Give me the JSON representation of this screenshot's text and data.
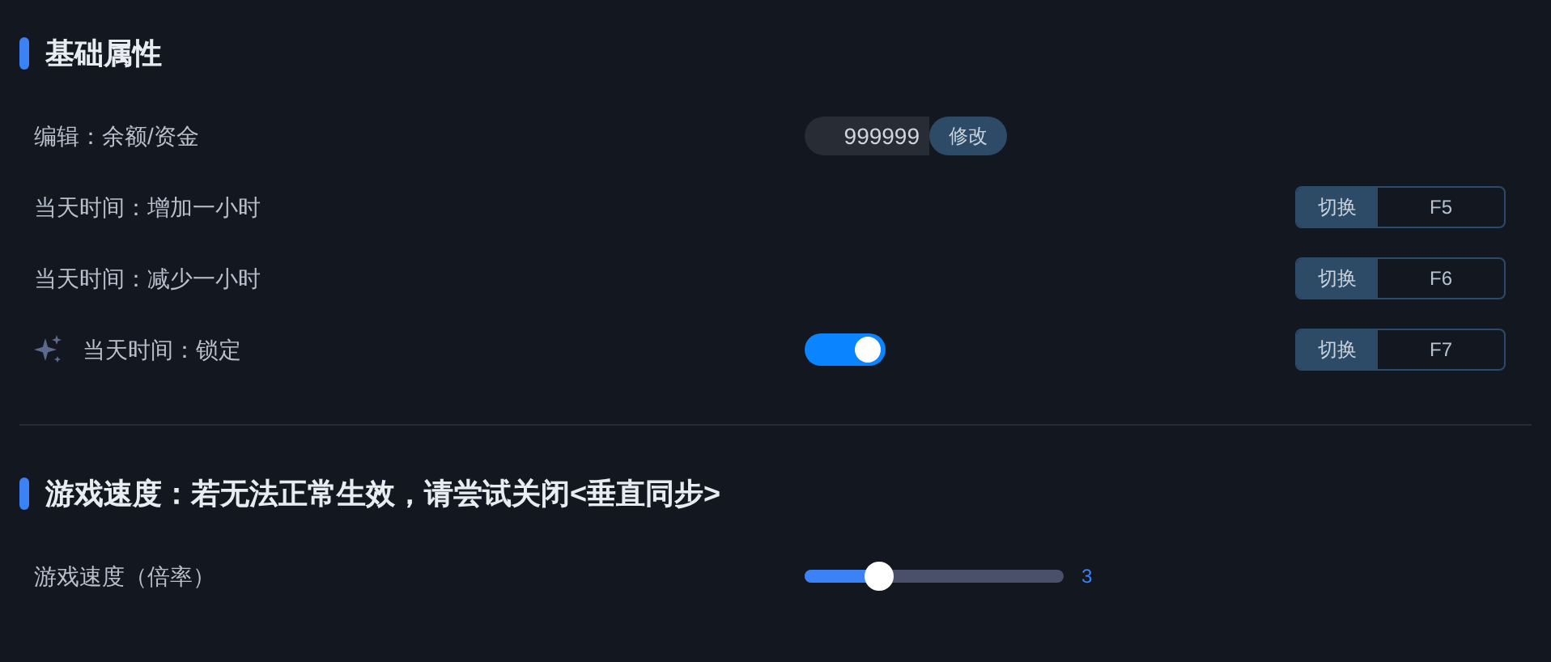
{
  "sections": [
    {
      "title": "基础属性",
      "rows": [
        {
          "kind": "input",
          "label": "编辑：余额/资金",
          "value": "999999",
          "button": "修改"
        },
        {
          "kind": "hotkey",
          "label": "当天时间：增加一小时",
          "switch": "切换",
          "key": "F5"
        },
        {
          "kind": "hotkey",
          "label": "当天时间：减少一小时",
          "switch": "切换",
          "key": "F6"
        },
        {
          "kind": "toggle",
          "label": "当天时间：锁定",
          "on": true,
          "switch": "切换",
          "key": "F7"
        }
      ]
    },
    {
      "title": "游戏速度：若无法正常生效，请尝试关闭<垂直同步>",
      "rows": [
        {
          "kind": "slider",
          "label": "游戏速度（倍率）",
          "level": 0.29,
          "reading": "3"
        }
      ]
    }
  ]
}
